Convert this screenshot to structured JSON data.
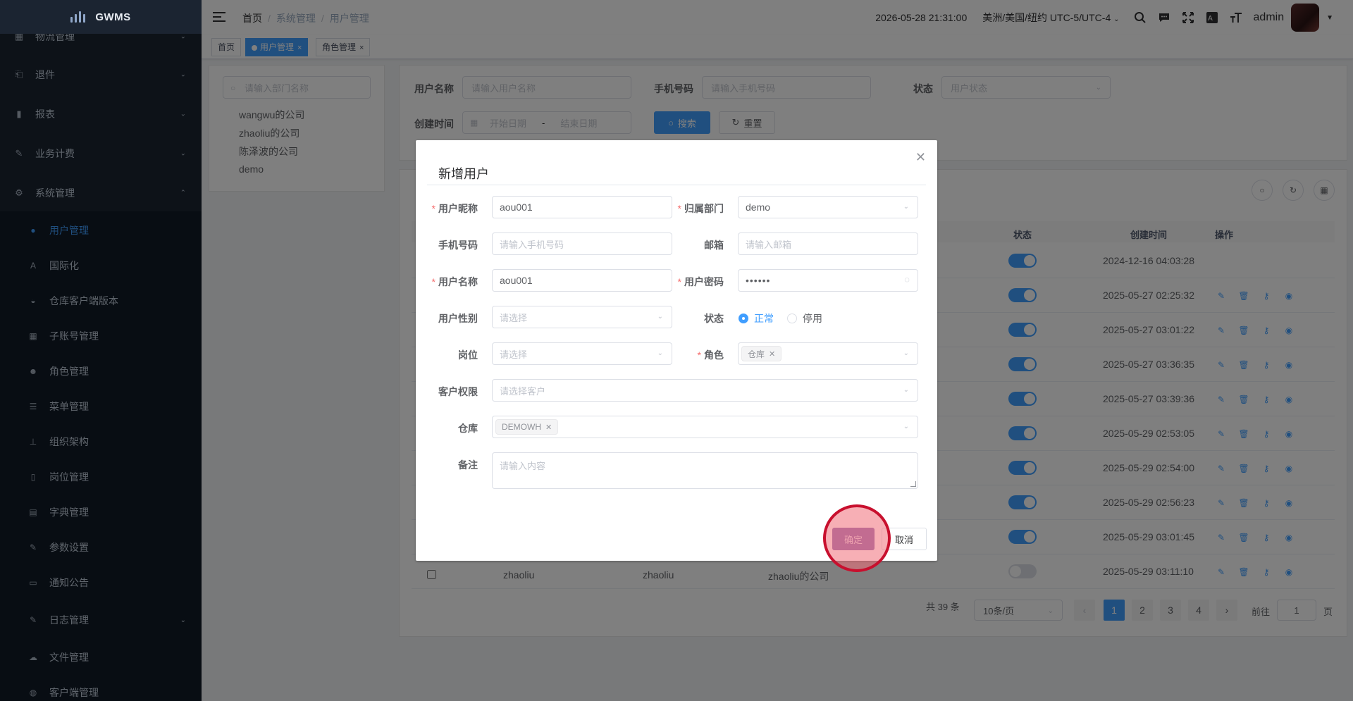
{
  "app": {
    "name": "GWMS"
  },
  "sidebar": {
    "items": [
      {
        "label": "物流管理",
        "icon": "grid-icon"
      },
      {
        "label": "退件",
        "icon": "return-icon"
      },
      {
        "label": "报表",
        "icon": "bar-chart-icon"
      },
      {
        "label": "业务计费",
        "icon": "edit-icon"
      },
      {
        "label": "系统管理",
        "icon": "gear-icon"
      }
    ],
    "sub_items": [
      {
        "label": "用户管理",
        "icon": "user-icon",
        "active": true
      },
      {
        "label": "国际化",
        "icon": "language-icon"
      },
      {
        "label": "仓库客户端版本",
        "icon": "android-icon"
      },
      {
        "label": "子账号管理",
        "icon": "grid-icon"
      },
      {
        "label": "角色管理",
        "icon": "people-icon"
      },
      {
        "label": "菜单管理",
        "icon": "tree-table-icon"
      },
      {
        "label": "组织架构",
        "icon": "tree-icon"
      },
      {
        "label": "岗位管理",
        "icon": "post-icon"
      },
      {
        "label": "字典管理",
        "icon": "dict-icon"
      },
      {
        "label": "参数设置",
        "icon": "edit-icon"
      },
      {
        "label": "通知公告",
        "icon": "message-icon"
      },
      {
        "label": "日志管理",
        "icon": "log-icon"
      },
      {
        "label": "文件管理",
        "icon": "upload-icon"
      },
      {
        "label": "客户端管理",
        "icon": "client-icon"
      }
    ]
  },
  "navbar": {
    "breadcrumb": [
      "首页",
      "系统管理",
      "用户管理"
    ],
    "datetime": "2026-05-28 21:31:00",
    "timezone": "美洲/美国/纽约 UTC-5/UTC-4",
    "user": "admin"
  },
  "tags": [
    {
      "label": "首页"
    },
    {
      "label": "用户管理",
      "active": true
    },
    {
      "label": "角色管理"
    }
  ],
  "dept_tree": {
    "placeholder": "请输入部门名称",
    "nodes": [
      "wangwu的公司",
      "zhaoliu的公司",
      "陈泽波的公司",
      "demo"
    ]
  },
  "query_form": {
    "username_label": "用户名称",
    "username_placeholder": "请输入用户名称",
    "phone_label": "手机号码",
    "phone_placeholder": "请输入手机号码",
    "status_label": "状态",
    "status_placeholder": "用户状态",
    "created_label": "创建时间",
    "start_placeholder": "开始日期",
    "range_sep": "-",
    "end_placeholder": "结束日期",
    "search_btn": "搜索",
    "reset_btn": "重置"
  },
  "table": {
    "headers": {
      "status": "状态",
      "created": "创建时间",
      "actions": "操作"
    },
    "rows": [
      {
        "created": "2024-12-16 04:03:28",
        "status_on": true,
        "actions": false
      },
      {
        "created": "2025-05-27 02:25:32",
        "status_on": true,
        "actions": true
      },
      {
        "created": "2025-05-27 03:01:22",
        "status_on": true,
        "actions": true
      },
      {
        "created": "2025-05-27 03:36:35",
        "status_on": true,
        "actions": true
      },
      {
        "created": "2025-05-27 03:39:36",
        "status_on": true,
        "actions": true
      },
      {
        "created": "2025-05-29 02:53:05",
        "status_on": true,
        "actions": true
      },
      {
        "created": "2025-05-29 02:54:00",
        "status_on": true,
        "actions": true
      },
      {
        "created": "2025-05-29 02:56:23",
        "status_on": true,
        "actions": true
      },
      {
        "created": "2025-05-29 03:01:45",
        "status_on": true,
        "actions": true
      },
      {
        "created": "2025-05-29 03:11:10",
        "status_on": false,
        "actions": true,
        "username": "zhaoliu",
        "nickname": "zhaoliu",
        "dept": "zhaoliu的公司"
      }
    ]
  },
  "pagination": {
    "total": "共 39 条",
    "page_size": "10条/页",
    "pages": [
      "1",
      "2",
      "3",
      "4"
    ],
    "current": "1",
    "goto_label": "前往",
    "goto_value": "1",
    "page_suffix": "页"
  },
  "dialog": {
    "title": "新增用户",
    "nickname_label": "用户昵称",
    "nickname_value": "aou001",
    "dept_label": "归属部门",
    "dept_value": "demo",
    "phone_label": "手机号码",
    "phone_placeholder": "请输入手机号码",
    "email_label": "邮箱",
    "email_placeholder": "请输入邮箱",
    "username_label": "用户名称",
    "username_value": "aou001",
    "password_label": "用户密码",
    "password_mask": "••••••",
    "gender_label": "用户性别",
    "gender_placeholder": "请选择",
    "status_label": "状态",
    "status_options": [
      "正常",
      "停用"
    ],
    "post_label": "岗位",
    "post_placeholder": "请选择",
    "role_label": "角色",
    "role_tag": "仓库",
    "customer_label": "客户权限",
    "customer_placeholder": "请选择客户",
    "warehouse_label": "仓库",
    "warehouse_tag": "DEMOWH",
    "remark_label": "备注",
    "remark_placeholder": "请输入内容",
    "ok_btn": "确定",
    "cancel_btn": "取消"
  },
  "colors": {
    "primary": "#409eff",
    "sidebar_bg": "#1b2431",
    "submenu_bg": "#111a26",
    "required": "#f56c6c",
    "click_ring": "#c8102e"
  }
}
